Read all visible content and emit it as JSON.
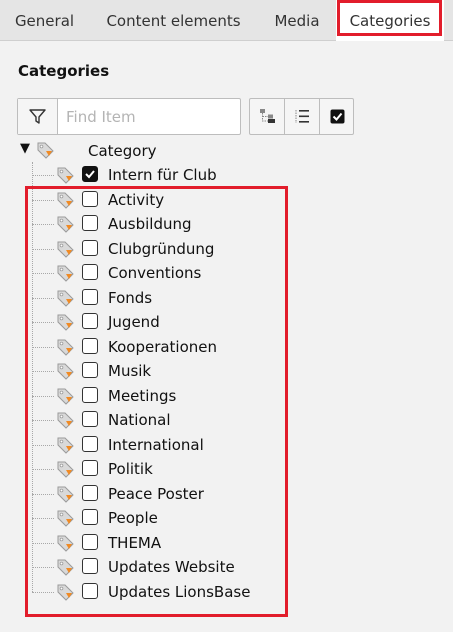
{
  "tabs": [
    {
      "label": "General"
    },
    {
      "label": "Content elements"
    },
    {
      "label": "Media"
    },
    {
      "label": "Categories"
    }
  ],
  "active_tab": "Categories",
  "section_title": "Categories",
  "search": {
    "placeholder": "Find Item",
    "value": ""
  },
  "toolbar": {
    "icons": [
      "filter-icon",
      "tree-collapse-icon",
      "tree-expand-icon",
      "select-all-icon"
    ]
  },
  "tree": {
    "root_label": "Category",
    "root_expanded": true,
    "items": [
      {
        "label": "Intern für Club",
        "checked": true
      },
      {
        "label": "Activity",
        "checked": false
      },
      {
        "label": "Ausbildung",
        "checked": false
      },
      {
        "label": "Clubgründung",
        "checked": false
      },
      {
        "label": "Conventions",
        "checked": false
      },
      {
        "label": "Fonds",
        "checked": false
      },
      {
        "label": "Jugend",
        "checked": false
      },
      {
        "label": "Kooperationen",
        "checked": false
      },
      {
        "label": "Musik",
        "checked": false
      },
      {
        "label": "Meetings",
        "checked": false
      },
      {
        "label": "National",
        "checked": false
      },
      {
        "label": "International",
        "checked": false
      },
      {
        "label": "Politik",
        "checked": false
      },
      {
        "label": "Peace Poster",
        "checked": false
      },
      {
        "label": "People",
        "checked": false
      },
      {
        "label": "THEMA",
        "checked": false
      },
      {
        "label": "Updates Website",
        "checked": false
      },
      {
        "label": "Updates LionsBase",
        "checked": false
      }
    ]
  },
  "colors": {
    "highlight": "#e21d2b",
    "tag_orange": "#f08a24",
    "tag_grey": "#c7c7c7"
  }
}
